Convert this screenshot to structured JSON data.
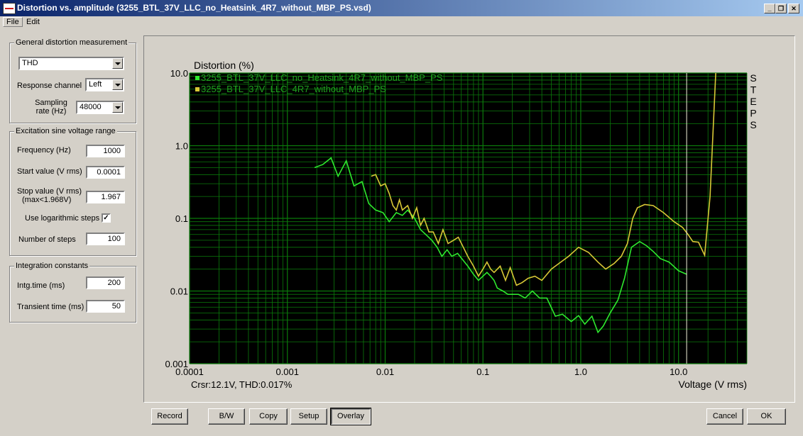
{
  "window": {
    "title": "Distortion vs. amplitude (3255_BTL_37V_LLC_no_Heatsink_4R7_without_MBP_PS.vsd)",
    "minimize": "_",
    "restore": "❐",
    "close": "✕"
  },
  "menu": {
    "file": "File",
    "edit": "Edit"
  },
  "general": {
    "title": "General distortion measurement",
    "measure_value": "THD",
    "response_label": "Response channel",
    "response_value": "Left",
    "sampling_label_1": "Sampling",
    "sampling_label_2": "rate (Hz)",
    "sampling_value": "48000"
  },
  "excitation": {
    "title": "Excitation sine voltage range",
    "freq_label": "Frequency (Hz)",
    "freq_value": "1000",
    "start_label": "Start value (V rms)",
    "start_value": "0.0001",
    "stop_label_1": "Stop value (V rms)",
    "stop_label_2": "(max<1.968V)",
    "stop_value": "1.967",
    "log_label": "Use logarithmic steps",
    "log_checked": "✓",
    "steps_label": "Number of steps",
    "steps_value": "100"
  },
  "integration": {
    "title": "Integration constants",
    "intg_label": "Intg.time (ms)",
    "intg_value": "200",
    "trans_label": "Transient time (ms)",
    "trans_value": "50"
  },
  "buttons": {
    "record": "Record",
    "bw": "B/W",
    "copy": "Copy",
    "setup": "Setup",
    "overlay": "Overlay",
    "cancel": "Cancel",
    "ok": "OK"
  },
  "colors": {
    "plot_bg": "#000000",
    "grid": "#0b7a0b",
    "series1": "#2ee82e",
    "series2": "#d8c836",
    "cursor": "#f0f0d8"
  },
  "chart_data": {
    "type": "line",
    "ylabel": "Distortion (%)",
    "xlabel": "Voltage (V rms)",
    "right_label": "STEPS",
    "cursor_text": "Crsr:12.1V, THD:0.017%",
    "cursor_x": 12.1,
    "x_scale": "log",
    "y_scale": "log",
    "xlim": [
      0.0001,
      50
    ],
    "ylim": [
      0.001,
      10
    ],
    "x_ticks": [
      0.0001,
      0.001,
      0.01,
      0.1,
      1,
      10
    ],
    "x_tick_labels": [
      "0.0001",
      "0.001",
      "0.01",
      "0.1",
      "1.0",
      "10.0"
    ],
    "y_ticks": [
      10,
      1,
      0.1,
      0.01,
      0.001
    ],
    "y_tick_labels": [
      "10.0",
      "1.0",
      "0.1",
      "0.01",
      "0.001"
    ],
    "grid": true,
    "legend_position": "top-left",
    "series": [
      {
        "name": "3255_BTL_37V_LLC_no_Heatsink_4R7_without_MBP_PS",
        "x": [
          0.0019,
          0.0023,
          0.0028,
          0.0033,
          0.004,
          0.0048,
          0.0058,
          0.0068,
          0.008,
          0.0095,
          0.011,
          0.013,
          0.015,
          0.017,
          0.02,
          0.023,
          0.026,
          0.03,
          0.034,
          0.038,
          0.043,
          0.048,
          0.055,
          0.062,
          0.07,
          0.08,
          0.09,
          0.1,
          0.11,
          0.12,
          0.13,
          0.14,
          0.16,
          0.18,
          0.2,
          0.23,
          0.27,
          0.32,
          0.38,
          0.45,
          0.55,
          0.65,
          0.8,
          0.95,
          1.1,
          1.3,
          1.5,
          1.7,
          2.0,
          2.4,
          2.8,
          3.3,
          4.0,
          4.7,
          5.5,
          6.5,
          8.0,
          10.0,
          12.1
        ],
        "y": [
          0.5,
          0.55,
          0.68,
          0.38,
          0.62,
          0.28,
          0.32,
          0.16,
          0.13,
          0.12,
          0.09,
          0.12,
          0.11,
          0.13,
          0.1,
          0.07,
          0.06,
          0.05,
          0.04,
          0.03,
          0.037,
          0.03,
          0.033,
          0.027,
          0.022,
          0.017,
          0.014,
          0.016,
          0.018,
          0.016,
          0.014,
          0.011,
          0.01,
          0.009,
          0.009,
          0.009,
          0.008,
          0.01,
          0.008,
          0.008,
          0.0045,
          0.0048,
          0.0038,
          0.0046,
          0.0035,
          0.0045,
          0.0027,
          0.0033,
          0.005,
          0.0075,
          0.015,
          0.04,
          0.048,
          0.042,
          0.035,
          0.028,
          0.025,
          0.019,
          0.017
        ]
      },
      {
        "name": "3255_BTL_37V_LLC_4R7_without_MBP_PS",
        "x": [
          0.0072,
          0.008,
          0.009,
          0.01,
          0.011,
          0.012,
          0.013,
          0.014,
          0.015,
          0.017,
          0.019,
          0.021,
          0.023,
          0.025,
          0.028,
          0.031,
          0.035,
          0.039,
          0.044,
          0.05,
          0.056,
          0.063,
          0.07,
          0.08,
          0.09,
          0.1,
          0.11,
          0.12,
          0.13,
          0.15,
          0.17,
          0.19,
          0.22,
          0.25,
          0.29,
          0.34,
          0.4,
          0.5,
          0.6,
          0.75,
          0.95,
          1.2,
          1.5,
          1.8,
          2.2,
          2.6,
          3.0,
          3.4,
          3.8,
          4.5,
          5.5,
          7.0,
          9.0,
          11.0,
          12.5,
          14.0,
          16.0,
          18.5,
          21.0,
          24.0
        ],
        "y": [
          0.38,
          0.4,
          0.28,
          0.3,
          0.22,
          0.15,
          0.13,
          0.18,
          0.13,
          0.15,
          0.1,
          0.14,
          0.08,
          0.1,
          0.065,
          0.065,
          0.045,
          0.07,
          0.045,
          0.05,
          0.055,
          0.04,
          0.03,
          0.022,
          0.016,
          0.02,
          0.025,
          0.02,
          0.018,
          0.022,
          0.014,
          0.021,
          0.012,
          0.013,
          0.015,
          0.016,
          0.014,
          0.02,
          0.024,
          0.03,
          0.04,
          0.034,
          0.025,
          0.02,
          0.024,
          0.03,
          0.045,
          0.1,
          0.14,
          0.155,
          0.15,
          0.12,
          0.09,
          0.075,
          0.06,
          0.048,
          0.047,
          0.031,
          0.2,
          10
        ]
      }
    ]
  }
}
